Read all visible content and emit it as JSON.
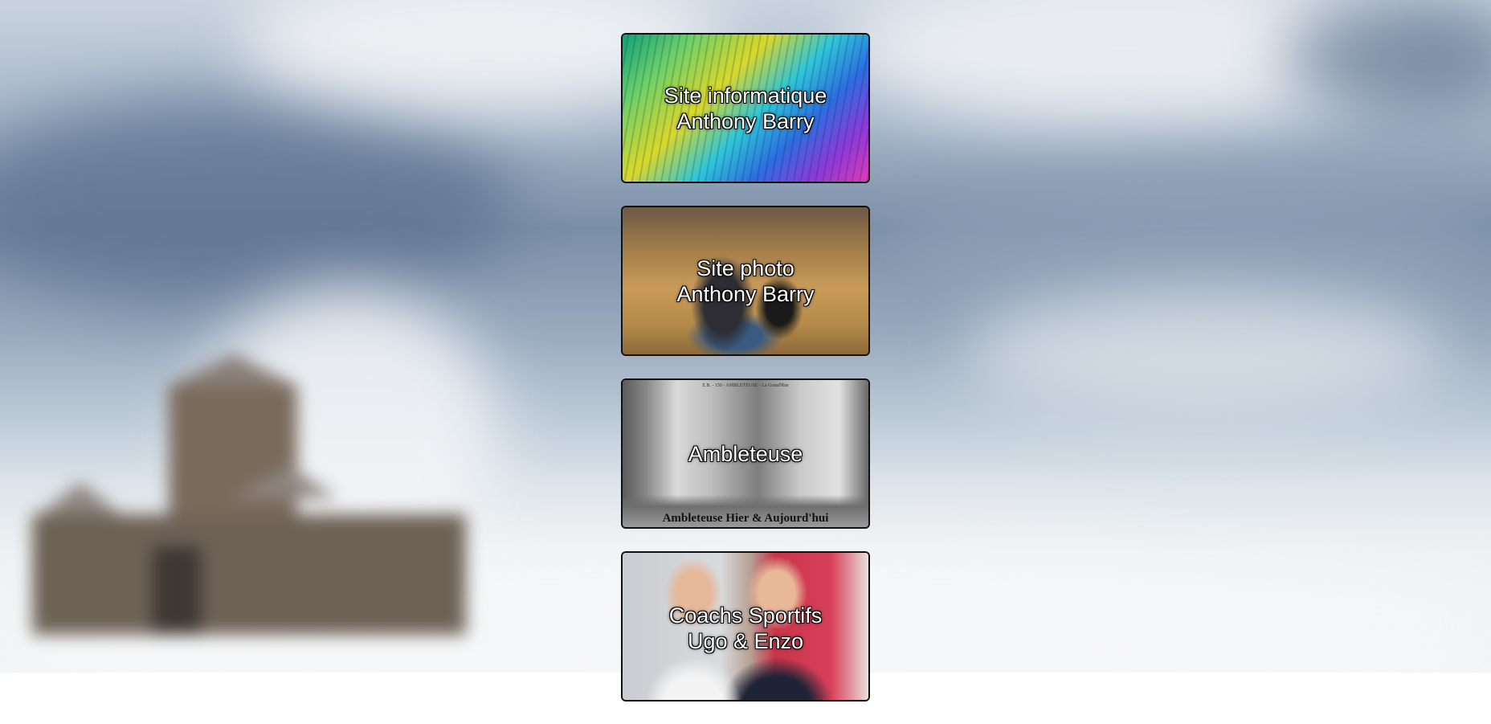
{
  "cards": [
    {
      "line1": "Site informatique",
      "line2": "Anthony Barry"
    },
    {
      "line1": "Site photo",
      "line2": "Anthony Barry"
    },
    {
      "line1": "Ambleteuse",
      "line2": "",
      "caption": "Ambleteuse Hier & Aujourd'hui",
      "topline": "E.B. - 150 - AMBLETEUSE - La Grand'Rue"
    },
    {
      "line1": "Coachs Sportifs",
      "line2": "Ugo & Enzo"
    }
  ],
  "colors": {
    "card_border": "#111111",
    "label_text": "#ffffff"
  }
}
